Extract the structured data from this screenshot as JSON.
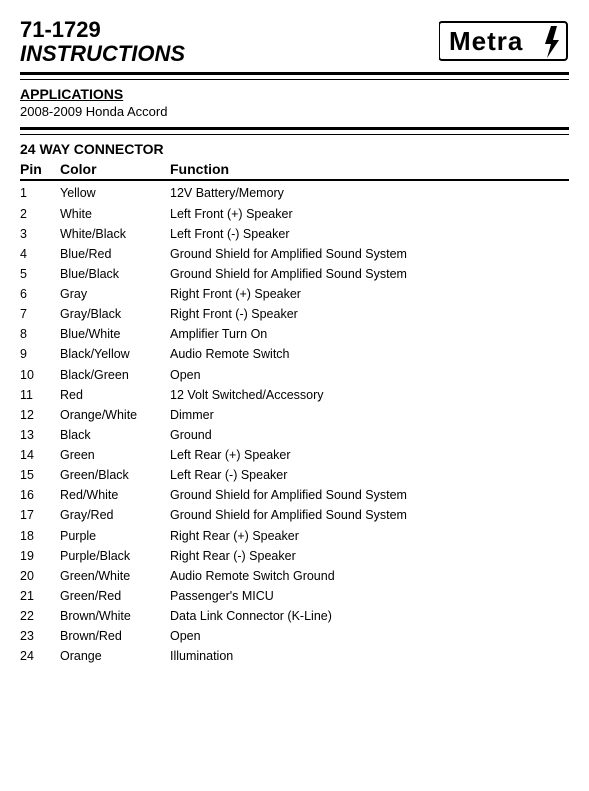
{
  "header": {
    "part_number": "71-1729",
    "instructions": "INSTRUCTIONS"
  },
  "applications": {
    "label": "APPLICATIONS",
    "vehicle": "2008-2009 Honda Accord"
  },
  "connector": {
    "label": "24 WAY CONNECTOR",
    "columns": {
      "pin": "Pin",
      "color": "Color",
      "function": "Function"
    },
    "rows": [
      {
        "pin": "1",
        "color": "Yellow",
        "function": "12V Battery/Memory"
      },
      {
        "pin": "2",
        "color": "White",
        "function": "Left Front (+) Speaker"
      },
      {
        "pin": "3",
        "color": "White/Black",
        "function": "Left Front (-) Speaker"
      },
      {
        "pin": "4",
        "color": "Blue/Red",
        "function": "Ground Shield for Amplified Sound System"
      },
      {
        "pin": "5",
        "color": "Blue/Black",
        "function": "Ground Shield for Amplified Sound System"
      },
      {
        "pin": "6",
        "color": "Gray",
        "function": "Right Front  (+) Speaker"
      },
      {
        "pin": "7",
        "color": "Gray/Black",
        "function": "Right Front  (-) Speaker"
      },
      {
        "pin": "8",
        "color": "Blue/White",
        "function": "Amplifier Turn On"
      },
      {
        "pin": "9",
        "color": "Black/Yellow",
        "function": "Audio Remote Switch"
      },
      {
        "pin": "10",
        "color": "Black/Green",
        "function": "Open"
      },
      {
        "pin": "11",
        "color": "Red",
        "function": "12 Volt Switched/Accessory"
      },
      {
        "pin": "12",
        "color": "Orange/White",
        "function": "Dimmer"
      },
      {
        "pin": "13",
        "color": "Black",
        "function": "Ground"
      },
      {
        "pin": "14",
        "color": "Green",
        "function": "Left Rear (+) Speaker"
      },
      {
        "pin": "15",
        "color": "Green/Black",
        "function": "Left Rear (-) Speaker"
      },
      {
        "pin": "16",
        "color": "Red/White",
        "function": "Ground Shield for Amplified Sound System"
      },
      {
        "pin": "17",
        "color": "Gray/Red",
        "function": "Ground Shield for Amplified Sound System"
      },
      {
        "pin": "18",
        "color": "Purple",
        "function": "Right Rear (+) Speaker"
      },
      {
        "pin": "19",
        "color": "Purple/Black",
        "function": "Right Rear (-) Speaker"
      },
      {
        "pin": "20",
        "color": "Green/White",
        "function": "Audio Remote Switch Ground"
      },
      {
        "pin": "21",
        "color": "Green/Red",
        "function": "Passenger's MICU"
      },
      {
        "pin": "22",
        "color": "Brown/White",
        "function": "Data Link Connector (K-Line)"
      },
      {
        "pin": "23",
        "color": "Brown/Red",
        "function": "Open"
      },
      {
        "pin": "24",
        "color": "Orange",
        "function": "Illumination"
      }
    ]
  }
}
